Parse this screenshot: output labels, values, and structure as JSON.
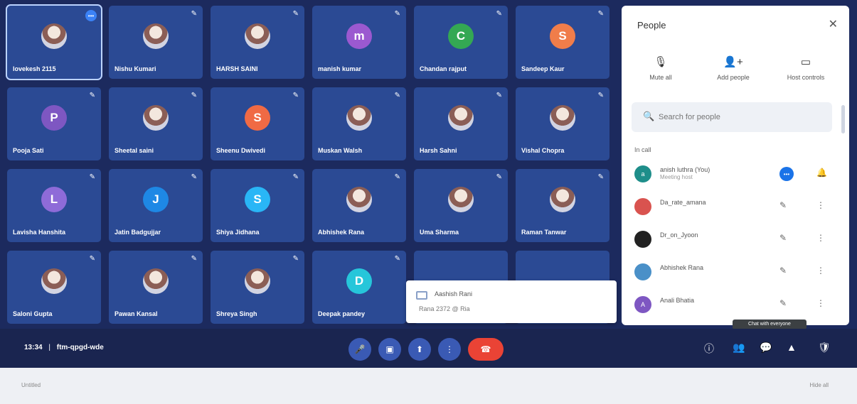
{
  "participants": [
    {
      "name": "lovekesh 2115",
      "avatar": "",
      "type": "photo",
      "speaking": true
    },
    {
      "name": "Nishu Kumari",
      "avatar": "",
      "type": "photo"
    },
    {
      "name": "HARSH SAINI",
      "avatar": "",
      "type": "photo"
    },
    {
      "name": "manish kumar",
      "avatar": "m",
      "type": "letter",
      "color": "#9b59d0"
    },
    {
      "name": "Chandan rajput",
      "avatar": "C",
      "type": "letter",
      "color": "#34a853"
    },
    {
      "name": "Sandeep Kaur",
      "avatar": "S",
      "type": "letter",
      "color": "#f07d4a"
    },
    {
      "name": "Pooja Sati",
      "avatar": "P",
      "type": "letter",
      "color": "#7e57c2"
    },
    {
      "name": "Sheetal saini",
      "avatar": "",
      "type": "photo"
    },
    {
      "name": "Sheenu Dwivedi",
      "avatar": "S",
      "type": "letter",
      "color": "#f06a44"
    },
    {
      "name": "Muskan Walsh",
      "avatar": "",
      "type": "photo"
    },
    {
      "name": "Harsh Sahni",
      "avatar": "",
      "type": "photo"
    },
    {
      "name": "Vishal Chopra",
      "avatar": "",
      "type": "photo"
    },
    {
      "name": "Lavisha Hanshita",
      "avatar": "L",
      "type": "letter",
      "color": "#8e6bd8"
    },
    {
      "name": "Jatin Badgujjar",
      "avatar": "J",
      "type": "letter",
      "color": "#1e88e5"
    },
    {
      "name": "Shiya Jidhana",
      "avatar": "S",
      "type": "letter",
      "color": "#29b6f6"
    },
    {
      "name": "Abhishek Rana",
      "avatar": "",
      "type": "photo"
    },
    {
      "name": "Uma Sharma",
      "avatar": "",
      "type": "photo"
    },
    {
      "name": "Raman Tanwar",
      "avatar": "",
      "type": "photo"
    },
    {
      "name": "Saloni Gupta",
      "avatar": "",
      "type": "photo"
    },
    {
      "name": "Pawan Kansal",
      "avatar": "",
      "type": "photo"
    },
    {
      "name": "Shreya Singh",
      "avatar": "",
      "type": "photo"
    },
    {
      "name": "Deepak pandey",
      "avatar": "D",
      "type": "letter",
      "color": "#26c6da"
    }
  ],
  "toast": {
    "name": "Aashish Rani",
    "message": "Rana 2372 @ Ria"
  },
  "people_panel": {
    "title": "People",
    "close_icon": "close-icon",
    "actions": [
      {
        "label": "Mute all",
        "icon": "mic-off-icon"
      },
      {
        "label": "Add people",
        "icon": "add-person-icon"
      },
      {
        "label": "Host controls",
        "icon": "host-controls-icon"
      }
    ],
    "search_placeholder": "Search for people",
    "section_label": "In call",
    "rows": [
      {
        "name": "anish luthra (You)",
        "sub": "Meeting host",
        "avatar": "a",
        "color": "#1e8e8a"
      },
      {
        "name": "Da_rate_amana",
        "sub": "",
        "avatar": "",
        "color": "#d9534f"
      },
      {
        "name": "Dr_on_Jyoon",
        "sub": "",
        "avatar": "",
        "color": "#222222"
      },
      {
        "name": "Abhishek Rana",
        "sub": "",
        "avatar": "",
        "color": "#4a90c8"
      },
      {
        "name": "Anali Bhatia",
        "sub": "",
        "avatar": "A",
        "color": "#7e57c2"
      }
    ]
  },
  "bottom_bar": {
    "time": "13:34",
    "separator": "|",
    "meeting_code": "ftm-qpgd-wde"
  },
  "tooltip": "Chat with everyone",
  "strip": {
    "left": "Untitled",
    "right": "Hide all"
  }
}
